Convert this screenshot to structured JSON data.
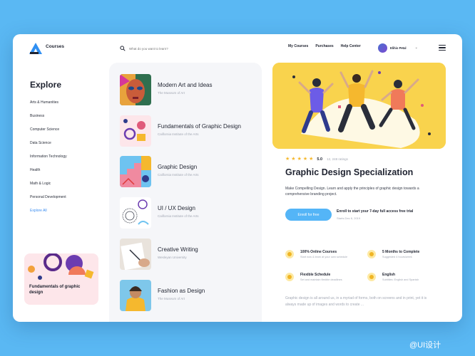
{
  "header": {
    "brand": "Courses",
    "search_placeholder": "What do you want to learn?",
    "nav": [
      "My Courses",
      "Purchases",
      "Help Center"
    ],
    "user_name": "Elihio Petal"
  },
  "sidebar": {
    "title": "Explore",
    "categories": [
      "Arts & Humanities",
      "Business",
      "Computer Science",
      "Data Science",
      "Information Technology",
      "Health",
      "Math & Logic",
      "Personal Development"
    ],
    "explore_all": "Explore All",
    "promo_title": "Fundamentals of graphic design"
  },
  "courses": [
    {
      "title": "Modern Art and Ideas",
      "subtitle": "The Museum of Art"
    },
    {
      "title": "Fundamentals of Graphic Design",
      "subtitle": "California Institute of the Arts"
    },
    {
      "title": "Graphic Design",
      "subtitle": "California Institute of the Arts"
    },
    {
      "title": "UI / UX Design",
      "subtitle": "California Institute of the Arts"
    },
    {
      "title": "Creative Writing",
      "subtitle": "Wesleyan University"
    },
    {
      "title": "Fashion as Design",
      "subtitle": "The Museum of Art"
    }
  ],
  "detail": {
    "rating": 5,
    "rating_value": "5.0",
    "rating_count": "12, 248 ratings",
    "title": "Graphic Design Specialization",
    "description": "Make Compelling Design. Learn and apply the principles of graphic design towards a comprehensive branding project.",
    "enroll_button": "Enroll for free",
    "enroll_text": "Enroll to start your 7-day full access free trial",
    "enroll_date": "Starts Dec 6, 2019",
    "features": [
      {
        "title": "100% Online Courses",
        "subtitle": "Start now & learn at your own schedule"
      },
      {
        "title": "5 Months to Complete",
        "subtitle": "Suggested 4 hours/week"
      },
      {
        "title": "Flexible Schedule",
        "subtitle": "Set and maintain flexible deadlines"
      },
      {
        "title": "English",
        "subtitle": "Subtitles: English and Spanish"
      }
    ],
    "body": "Graphic design is all around us, in a myriad of forms, both on screens and in print, yet it is always made up of images and words to create ..."
  },
  "colors": {
    "background": "#5ab8f3",
    "accent": "#54b5f7",
    "hero": "#f9d34d",
    "star": "#f5b82e"
  },
  "watermark": "@UI设计"
}
